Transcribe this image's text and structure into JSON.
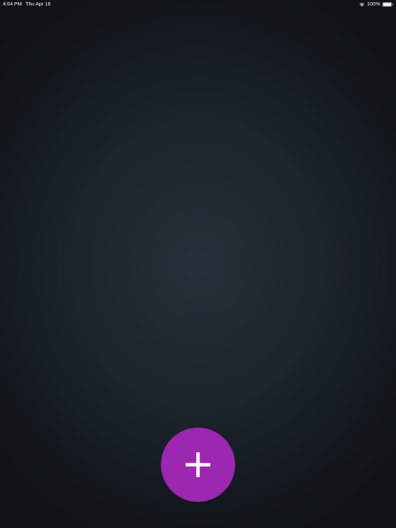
{
  "status_bar": {
    "time": "4:04 PM",
    "date": "Thu Apr 16",
    "battery_percent": "100%",
    "battery_level": 1.0
  },
  "fab": {
    "icon": "plus-icon",
    "color": "#9c27b0"
  },
  "colors": {
    "background_center": "#25303a",
    "background_edge": "#0f1317"
  }
}
